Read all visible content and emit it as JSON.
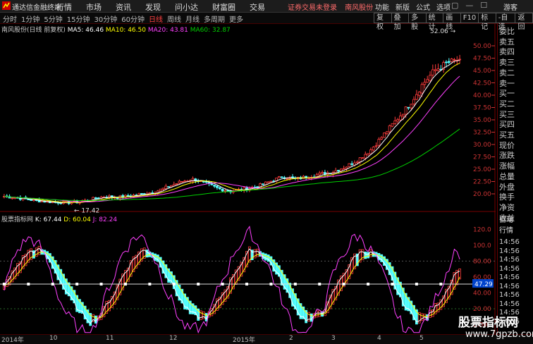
{
  "app": {
    "name": "通达信金融终端",
    "menu": [
      "行情",
      "市场",
      "资讯",
      "发现",
      "问小达",
      "财富圈",
      "交易"
    ],
    "title_notice": "证券交易未登录",
    "title_stock": "南风股份",
    "right_menu": [
      "功能",
      "新版",
      "公式",
      "选项"
    ],
    "guest": "游客"
  },
  "periods": [
    "分时",
    "1分钟",
    "5分钟",
    "15分钟",
    "30分钟",
    "60分钟",
    "日线",
    "周线",
    "月线",
    "多周期",
    "更多"
  ],
  "active_period": "日线",
  "tools": [
    "复权",
    "叠加",
    "多股",
    "统计",
    "画线",
    "F10",
    "标记",
    "-自选",
    "返回"
  ],
  "main_info": {
    "name": "南风股份(日线 前复权)",
    "ma": [
      {
        "label": "MA5: 46.46",
        "color": "#ffffff"
      },
      {
        "label": "MA10: 46.50",
        "color": "#ffff00"
      },
      {
        "label": "MA20: 43.81",
        "color": "#ff40ff"
      },
      {
        "label": "MA60: 32.87",
        "color": "#00d000"
      }
    ]
  },
  "sub_info": {
    "name": "股票指标网",
    "vals": [
      {
        "label": "K: 67.44",
        "color": "#ffffff"
      },
      {
        "label": "D: 60.04",
        "color": "#ffff00"
      },
      {
        "label": "J: 82.24",
        "color": "#ff40ff"
      }
    ]
  },
  "price_axis": [
    "50.00",
    "47.50",
    "45.00",
    "42.50",
    "40.00",
    "37.50",
    "35.00",
    "32.50",
    "30.00",
    "27.50",
    "25.00",
    "22.50",
    "20.00"
  ],
  "ind_axis": [
    "120.0",
    "100.0",
    "80.00",
    "60.00",
    "40.00",
    "20.00",
    "0.00"
  ],
  "marks": {
    "high": "52.06",
    "low": "17.42",
    "current": "47.29"
  },
  "right_panel": [
    "委比",
    "卖五",
    "卖四",
    "卖三",
    "卖二",
    "卖一",
    "买一",
    "买二",
    "买三",
    "买四",
    "买五",
    "现价",
    "涨跌",
    "涨幅",
    "总量",
    "外盘",
    "换手",
    "净资",
    "收益"
  ],
  "right_tabs": [
    "自动",
    "行情"
  ],
  "right_times": [
    "14:56",
    "14:56",
    "14:56",
    "14:56",
    "14:56",
    "14:56",
    "14:56",
    "14:56",
    "14:56",
    "14:56"
  ],
  "time_axis": [
    "2014年",
    "10",
    "11",
    "12",
    "2015年",
    "2",
    "3",
    "4",
    "5"
  ],
  "watermark": {
    "line1": "股票指标网",
    "line2": "www.7gpzb.com"
  },
  "chart_data": {
    "type": "candlestick",
    "title": "南风股份(日线 前复权)",
    "ylim": [
      17,
      53
    ],
    "close_trend": [
      19.5,
      19.2,
      18.8,
      18.5,
      18.3,
      18.2,
      18.4,
      19.0,
      19.5,
      19.3,
      19.6,
      20.0,
      20.5,
      21.5,
      22.5,
      23.0,
      22.0,
      21.0,
      20.5,
      21.0,
      21.5,
      22.5,
      23.5,
      23.0,
      23.5,
      24.0,
      24.5,
      25.5,
      27.0,
      29.0,
      32.0,
      35.0,
      38.0,
      42.0,
      45.0,
      46.5,
      47.29
    ],
    "ma60_end": 32.87,
    "indicator": {
      "name": "股票指标网",
      "K": 67.44,
      "D": 60.04,
      "J": 82.24,
      "ylim": [
        0,
        120
      ]
    }
  }
}
